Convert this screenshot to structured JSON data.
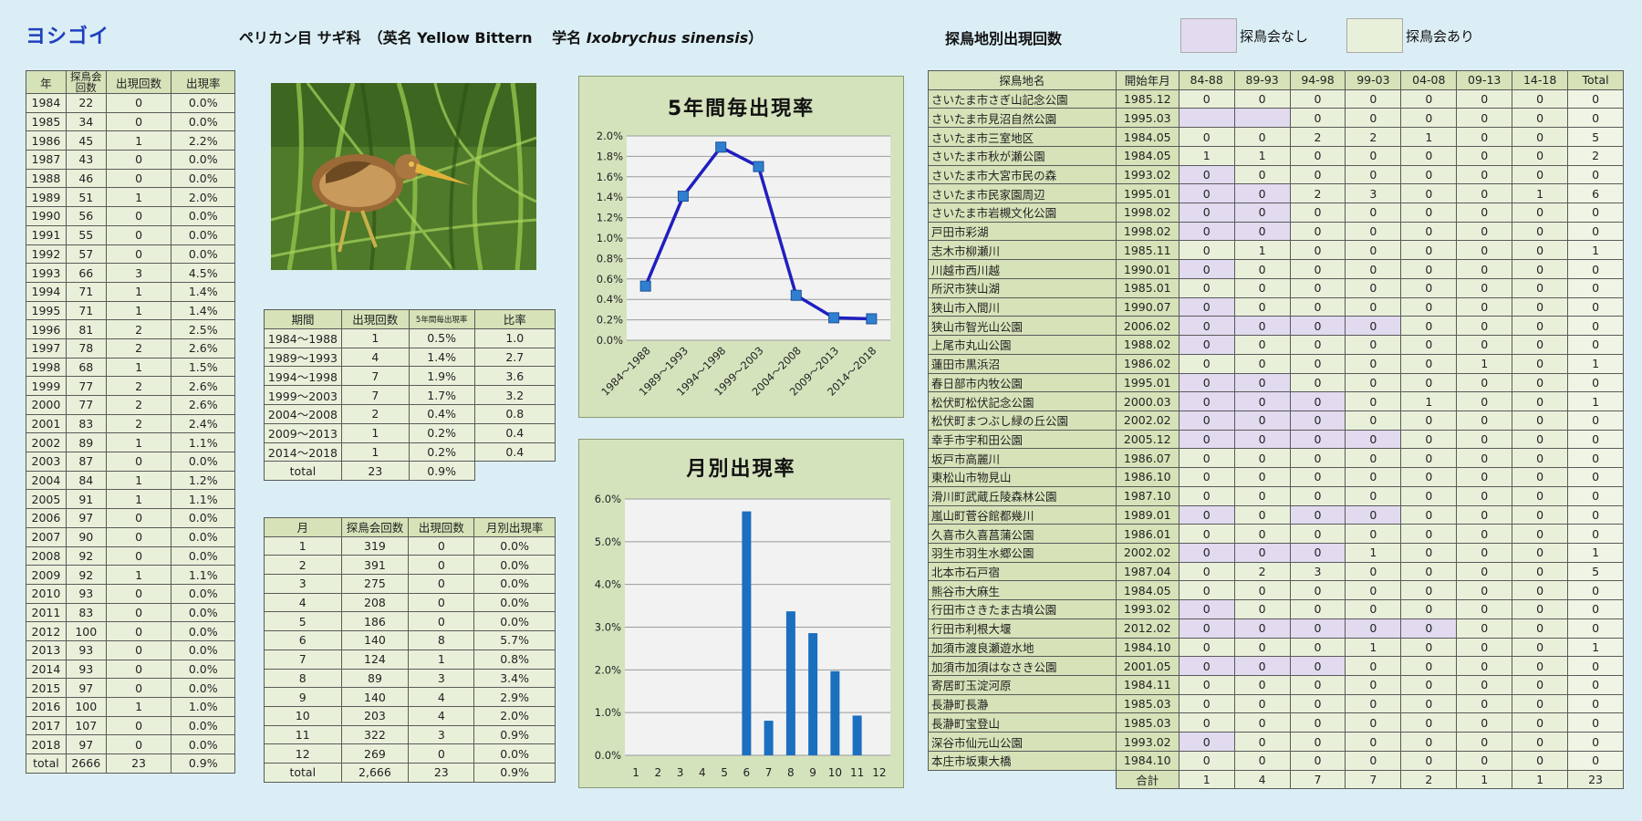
{
  "header": {
    "species": "ヨシゴイ",
    "taxonomy_prefix": "ペリカン目 サギ科　（英名 Yellow Bittern　 学名 ",
    "scientific_name": "Ixobrychus sinensis",
    "taxonomy_suffix": "）",
    "sites_heading": "探鳥地別出現回数"
  },
  "legend": [
    {
      "label": "探鳥会なし",
      "color": "#e2daef"
    },
    {
      "label": "探鳥会あり",
      "color": "#e9f0da"
    }
  ],
  "photo": {
    "subject": "yellow-bittern"
  },
  "year_table": {
    "headers": [
      "年",
      "探鳥会回数",
      "出現回数",
      "出現率"
    ],
    "rows": [
      [
        "1984",
        "22",
        "0",
        "0.0%"
      ],
      [
        "1985",
        "34",
        "0",
        "0.0%"
      ],
      [
        "1986",
        "45",
        "1",
        "2.2%"
      ],
      [
        "1987",
        "43",
        "0",
        "0.0%"
      ],
      [
        "1988",
        "46",
        "0",
        "0.0%"
      ],
      [
        "1989",
        "51",
        "1",
        "2.0%"
      ],
      [
        "1990",
        "56",
        "0",
        "0.0%"
      ],
      [
        "1991",
        "55",
        "0",
        "0.0%"
      ],
      [
        "1992",
        "57",
        "0",
        "0.0%"
      ],
      [
        "1993",
        "66",
        "3",
        "4.5%"
      ],
      [
        "1994",
        "71",
        "1",
        "1.4%"
      ],
      [
        "1995",
        "71",
        "1",
        "1.4%"
      ],
      [
        "1996",
        "81",
        "2",
        "2.5%"
      ],
      [
        "1997",
        "78",
        "2",
        "2.6%"
      ],
      [
        "1998",
        "68",
        "1",
        "1.5%"
      ],
      [
        "1999",
        "77",
        "2",
        "2.6%"
      ],
      [
        "2000",
        "77",
        "2",
        "2.6%"
      ],
      [
        "2001",
        "83",
        "2",
        "2.4%"
      ],
      [
        "2002",
        "89",
        "1",
        "1.1%"
      ],
      [
        "2003",
        "87",
        "0",
        "0.0%"
      ],
      [
        "2004",
        "84",
        "1",
        "1.2%"
      ],
      [
        "2005",
        "91",
        "1",
        "1.1%"
      ],
      [
        "2006",
        "97",
        "0",
        "0.0%"
      ],
      [
        "2007",
        "90",
        "0",
        "0.0%"
      ],
      [
        "2008",
        "92",
        "0",
        "0.0%"
      ],
      [
        "2009",
        "92",
        "1",
        "1.1%"
      ],
      [
        "2010",
        "93",
        "0",
        "0.0%"
      ],
      [
        "2011",
        "83",
        "0",
        "0.0%"
      ],
      [
        "2012",
        "100",
        "0",
        "0.0%"
      ],
      [
        "2013",
        "93",
        "0",
        "0.0%"
      ],
      [
        "2014",
        "93",
        "0",
        "0.0%"
      ],
      [
        "2015",
        "97",
        "0",
        "0.0%"
      ],
      [
        "2016",
        "100",
        "1",
        "1.0%"
      ],
      [
        "2017",
        "107",
        "0",
        "0.0%"
      ],
      [
        "2018",
        "97",
        "0",
        "0.0%"
      ]
    ],
    "total": [
      "total",
      "2666",
      "23",
      "0.9%"
    ]
  },
  "period_table": {
    "headers": [
      "期間",
      "出現回数",
      "5年間毎出現率",
      "比率"
    ],
    "rows": [
      [
        "1984～1988",
        "1",
        "0.5%",
        "1.0"
      ],
      [
        "1989～1993",
        "4",
        "1.4%",
        "2.7"
      ],
      [
        "1994～1998",
        "7",
        "1.9%",
        "3.6"
      ],
      [
        "1999～2003",
        "7",
        "1.7%",
        "3.2"
      ],
      [
        "2004～2008",
        "2",
        "0.4%",
        "0.8"
      ],
      [
        "2009～2013",
        "1",
        "0.2%",
        "0.4"
      ],
      [
        "2014～2018",
        "1",
        "0.2%",
        "0.4"
      ]
    ],
    "total": [
      "total",
      "23",
      "0.9%"
    ]
  },
  "month_table": {
    "headers": [
      "月",
      "探鳥会回数",
      "出現回数",
      "月別出現率"
    ],
    "rows": [
      [
        "1",
        "319",
        "0",
        "0.0%"
      ],
      [
        "2",
        "391",
        "0",
        "0.0%"
      ],
      [
        "3",
        "275",
        "0",
        "0.0%"
      ],
      [
        "4",
        "208",
        "0",
        "0.0%"
      ],
      [
        "5",
        "186",
        "0",
        "0.0%"
      ],
      [
        "6",
        "140",
        "8",
        "5.7%"
      ],
      [
        "7",
        "124",
        "1",
        "0.8%"
      ],
      [
        "8",
        "89",
        "3",
        "3.4%"
      ],
      [
        "9",
        "140",
        "4",
        "2.9%"
      ],
      [
        "10",
        "203",
        "4",
        "2.0%"
      ],
      [
        "11",
        "322",
        "3",
        "0.9%"
      ],
      [
        "12",
        "269",
        "0",
        "0.0%"
      ]
    ],
    "total": [
      "total",
      "2,666",
      "23",
      "0.9%"
    ]
  },
  "site_table": {
    "headers": [
      "探鳥地名",
      "開始年月",
      "84-88",
      "89-93",
      "94-98",
      "99-03",
      "04-08",
      "09-13",
      "14-18",
      "Total"
    ],
    "rows": [
      {
        "name": "さいたま市さぎ山記念公園",
        "start": "1985.12",
        "vals": [
          "0",
          "0",
          "0",
          "0",
          "0",
          "0",
          "0",
          "0"
        ],
        "none": []
      },
      {
        "name": "さいたま市見沼自然公園",
        "start": "1995.03",
        "vals": [
          "",
          "",
          "0",
          "0",
          "0",
          "0",
          "0",
          "0"
        ],
        "none": [
          0,
          1
        ]
      },
      {
        "name": "さいたま市三室地区",
        "start": "1984.05",
        "vals": [
          "0",
          "0",
          "2",
          "2",
          "1",
          "0",
          "0",
          "5"
        ],
        "none": []
      },
      {
        "name": "さいたま市秋が瀬公園",
        "start": "1984.05",
        "vals": [
          "1",
          "1",
          "0",
          "0",
          "0",
          "0",
          "0",
          "2"
        ],
        "none": []
      },
      {
        "name": "さいたま市大宮市民の森",
        "start": "1993.02",
        "vals": [
          "0",
          "0",
          "0",
          "0",
          "0",
          "0",
          "0",
          "0"
        ],
        "none": [
          0
        ]
      },
      {
        "name": "さいたま市民家園周辺",
        "start": "1995.01",
        "vals": [
          "0",
          "0",
          "2",
          "3",
          "0",
          "0",
          "1",
          "6"
        ],
        "none": [
          0,
          1
        ]
      },
      {
        "name": "さいたま市岩槻文化公園",
        "start": "1998.02",
        "vals": [
          "0",
          "0",
          "0",
          "0",
          "0",
          "0",
          "0",
          "0"
        ],
        "none": [
          0,
          1
        ]
      },
      {
        "name": "戸田市彩湖",
        "start": "1998.02",
        "vals": [
          "0",
          "0",
          "0",
          "0",
          "0",
          "0",
          "0",
          "0"
        ],
        "none": [
          0,
          1
        ]
      },
      {
        "name": "志木市柳瀬川",
        "start": "1985.11",
        "vals": [
          "0",
          "1",
          "0",
          "0",
          "0",
          "0",
          "0",
          "1"
        ],
        "none": []
      },
      {
        "name": "川越市西川越",
        "start": "1990.01",
        "vals": [
          "0",
          "0",
          "0",
          "0",
          "0",
          "0",
          "0",
          "0"
        ],
        "none": [
          0
        ]
      },
      {
        "name": "所沢市狭山湖",
        "start": "1985.01",
        "vals": [
          "0",
          "0",
          "0",
          "0",
          "0",
          "0",
          "0",
          "0"
        ],
        "none": []
      },
      {
        "name": "狭山市入間川",
        "start": "1990.07",
        "vals": [
          "0",
          "0",
          "0",
          "0",
          "0",
          "0",
          "0",
          "0"
        ],
        "none": [
          0
        ]
      },
      {
        "name": "狭山市智光山公園",
        "start": "2006.02",
        "vals": [
          "0",
          "0",
          "0",
          "0",
          "0",
          "0",
          "0",
          "0"
        ],
        "none": [
          0,
          1,
          2,
          3
        ]
      },
      {
        "name": "上尾市丸山公園",
        "start": "1988.02",
        "vals": [
          "0",
          "0",
          "0",
          "0",
          "0",
          "0",
          "0",
          "0"
        ],
        "none": [
          0
        ]
      },
      {
        "name": "蓮田市黒浜沼",
        "start": "1986.02",
        "vals": [
          "0",
          "0",
          "0",
          "0",
          "0",
          "1",
          "0",
          "1"
        ],
        "none": []
      },
      {
        "name": "春日部市内牧公園",
        "start": "1995.01",
        "vals": [
          "0",
          "0",
          "0",
          "0",
          "0",
          "0",
          "0",
          "0"
        ],
        "none": [
          0,
          1
        ]
      },
      {
        "name": "松伏町松伏記念公園",
        "start": "2000.03",
        "vals": [
          "0",
          "0",
          "0",
          "0",
          "1",
          "0",
          "0",
          "1"
        ],
        "none": [
          0,
          1,
          2
        ]
      },
      {
        "name": "松伏町まつぶし緑の丘公園",
        "start": "2002.02",
        "vals": [
          "0",
          "0",
          "0",
          "0",
          "0",
          "0",
          "0",
          "0"
        ],
        "none": [
          0,
          1,
          2
        ]
      },
      {
        "name": "幸手市宇和田公園",
        "start": "2005.12",
        "vals": [
          "0",
          "0",
          "0",
          "0",
          "0",
          "0",
          "0",
          "0"
        ],
        "none": [
          0,
          1,
          2,
          3
        ]
      },
      {
        "name": "坂戸市高麗川",
        "start": "1986.07",
        "vals": [
          "0",
          "0",
          "0",
          "0",
          "0",
          "0",
          "0",
          "0"
        ],
        "none": []
      },
      {
        "name": "東松山市物見山",
        "start": "1986.10",
        "vals": [
          "0",
          "0",
          "0",
          "0",
          "0",
          "0",
          "0",
          "0"
        ],
        "none": []
      },
      {
        "name": "滑川町武蔵丘陵森林公園",
        "start": "1987.10",
        "vals": [
          "0",
          "0",
          "0",
          "0",
          "0",
          "0",
          "0",
          "0"
        ],
        "none": []
      },
      {
        "name": "嵐山町菅谷館都幾川",
        "start": "1989.01",
        "vals": [
          "0",
          "0",
          "0",
          "0",
          "0",
          "0",
          "0",
          "0"
        ],
        "none": [
          0,
          2,
          3
        ]
      },
      {
        "name": "久喜市久喜菖蒲公園",
        "start": "1986.01",
        "vals": [
          "0",
          "0",
          "0",
          "0",
          "0",
          "0",
          "0",
          "0"
        ],
        "none": []
      },
      {
        "name": "羽生市羽生水郷公園",
        "start": "2002.02",
        "vals": [
          "0",
          "0",
          "0",
          "1",
          "0",
          "0",
          "0",
          "1"
        ],
        "none": [
          0,
          1,
          2
        ]
      },
      {
        "name": "北本市石戸宿",
        "start": "1987.04",
        "vals": [
          "0",
          "2",
          "3",
          "0",
          "0",
          "0",
          "0",
          "5"
        ],
        "none": []
      },
      {
        "name": "熊谷市大麻生",
        "start": "1984.05",
        "vals": [
          "0",
          "0",
          "0",
          "0",
          "0",
          "0",
          "0",
          "0"
        ],
        "none": []
      },
      {
        "name": "行田市さきたま古墳公園",
        "start": "1993.02",
        "vals": [
          "0",
          "0",
          "0",
          "0",
          "0",
          "0",
          "0",
          "0"
        ],
        "none": [
          0
        ]
      },
      {
        "name": "行田市利根大堰",
        "start": "2012.02",
        "vals": [
          "0",
          "0",
          "0",
          "0",
          "0",
          "0",
          "0",
          "0"
        ],
        "none": [
          0,
          1,
          2,
          3,
          4
        ]
      },
      {
        "name": "加須市渡良瀬遊水地",
        "start": "1984.10",
        "vals": [
          "0",
          "0",
          "0",
          "1",
          "0",
          "0",
          "0",
          "1"
        ],
        "none": []
      },
      {
        "name": "加須市加須はなさき公園",
        "start": "2001.05",
        "vals": [
          "0",
          "0",
          "0",
          "0",
          "0",
          "0",
          "0",
          "0"
        ],
        "none": [
          0,
          1,
          2
        ]
      },
      {
        "name": "寄居町玉淀河原",
        "start": "1984.11",
        "vals": [
          "0",
          "0",
          "0",
          "0",
          "0",
          "0",
          "0",
          "0"
        ],
        "none": []
      },
      {
        "name": "長瀞町長瀞",
        "start": "1985.03",
        "vals": [
          "0",
          "0",
          "0",
          "0",
          "0",
          "0",
          "0",
          "0"
        ],
        "none": []
      },
      {
        "name": "長瀞町宝登山",
        "start": "1985.03",
        "vals": [
          "0",
          "0",
          "0",
          "0",
          "0",
          "0",
          "0",
          "0"
        ],
        "none": []
      },
      {
        "name": "深谷市仙元山公園",
        "start": "1993.02",
        "vals": [
          "0",
          "0",
          "0",
          "0",
          "0",
          "0",
          "0",
          "0"
        ],
        "none": [
          0
        ]
      },
      {
        "name": "本庄市坂東大橋",
        "start": "1984.10",
        "vals": [
          "0",
          "0",
          "0",
          "0",
          "0",
          "0",
          "0",
          "0"
        ],
        "none": []
      }
    ],
    "total_label": "合計",
    "totals": [
      "1",
      "4",
      "7",
      "7",
      "2",
      "1",
      "1",
      "23"
    ]
  },
  "chart_data": [
    {
      "type": "line",
      "title": "5年間毎出現率",
      "categories": [
        "1984～1988",
        "1989～1993",
        "1994～1998",
        "1999～2003",
        "2004～2008",
        "2009～2013",
        "2014～2018"
      ],
      "values": [
        0.53,
        1.41,
        1.89,
        1.7,
        0.44,
        0.22,
        0.21
      ],
      "yticks": [
        "0.0%",
        "0.2%",
        "0.4%",
        "0.6%",
        "0.8%",
        "1.0%",
        "1.2%",
        "1.4%",
        "1.6%",
        "1.8%",
        "2.0%"
      ],
      "ylim": [
        0,
        2.0
      ],
      "color": "#1f1fc0",
      "grid": true
    },
    {
      "type": "bar",
      "title": "月別出現率",
      "categories": [
        "1",
        "2",
        "3",
        "4",
        "5",
        "6",
        "7",
        "8",
        "9",
        "10",
        "11",
        "12"
      ],
      "values": [
        0,
        0,
        0,
        0,
        0,
        5.71,
        0.81,
        3.37,
        2.86,
        1.97,
        0.93,
        0
      ],
      "yticks": [
        "0.0%",
        "1.0%",
        "2.0%",
        "3.0%",
        "4.0%",
        "5.0%",
        "6.0%"
      ],
      "ylim": [
        0,
        6.0
      ],
      "color": "#1b6fbf",
      "grid": true
    }
  ]
}
